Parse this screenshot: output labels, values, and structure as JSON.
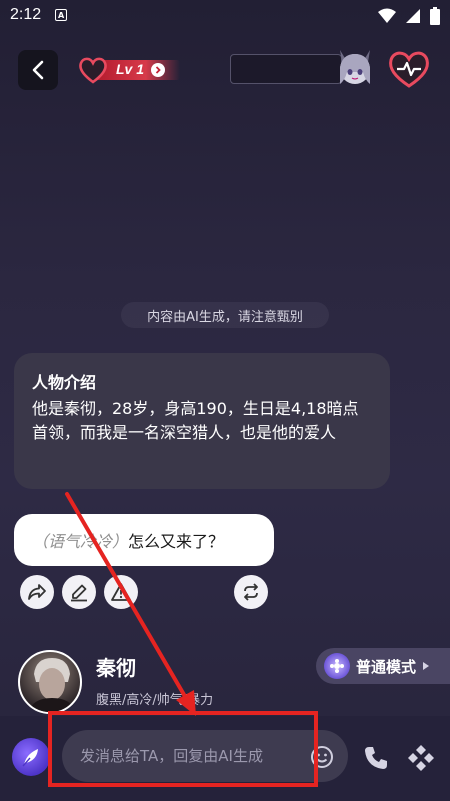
{
  "status_bar": {
    "time": "2:12",
    "badge": "A"
  },
  "header": {
    "level": "Lv 1"
  },
  "notice": "内容由AI生成，请注意甄别",
  "intro": {
    "title": "人物介绍",
    "text": "他是秦彻，28岁，身高190，生日是4,18暗点首领，而我是一名深空猎人，也是他的爱人"
  },
  "reply": {
    "tone": "（语气冷冷）",
    "text": "怎么又来了？"
  },
  "character": {
    "name": "秦彻",
    "tags": "腹黑/高冷/帅气/暴力"
  },
  "mode": {
    "label": "普通模式"
  },
  "input": {
    "placeholder": "发消息给TA，回复由AI生成"
  },
  "colors": {
    "accent": "#e84a5f",
    "annotation": "#e52421",
    "mode_purple": "#6d56d8"
  }
}
